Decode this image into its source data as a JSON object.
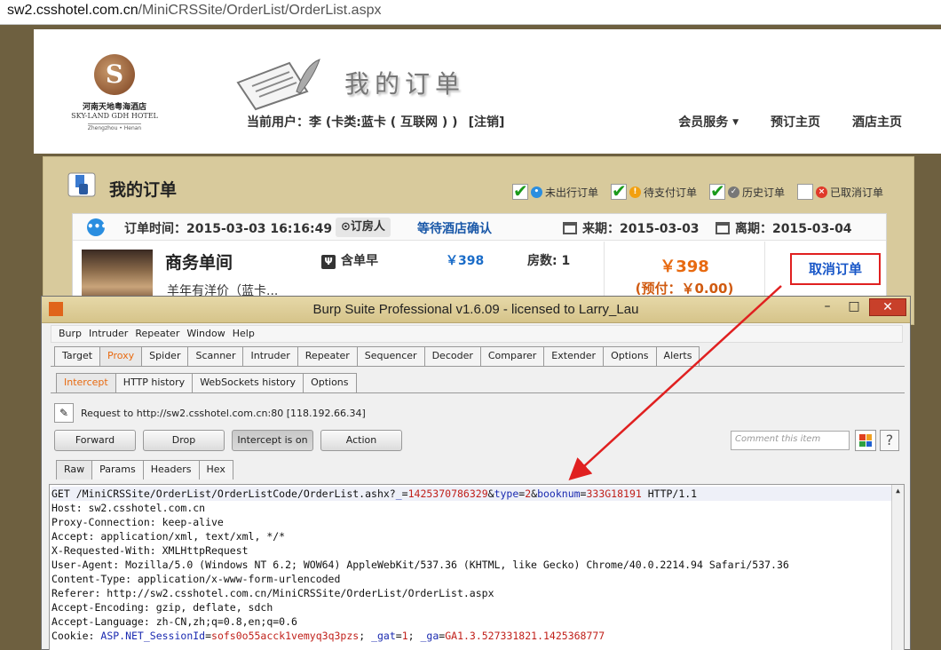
{
  "browser": {
    "url_host": "sw2.csshotel.com.cn",
    "url_path": "/MiniCRSSite/OrderList/OrderList.aspx"
  },
  "site": {
    "logo_cn": "河南天地粤海酒店",
    "logo_en": "SKY-LAND GDH HOTEL",
    "logo_sub": "Zhengzhou • Henan",
    "hero_title": "我的订单",
    "user_label": "当前用户：李 (卡类:蓝卡 ( 互联网 ) )",
    "logout": "[注销]",
    "nav": [
      "会员服务",
      "预订主页",
      "酒店主页"
    ]
  },
  "orders": {
    "title": "我的订单",
    "filters": [
      {
        "label": "未出行订单",
        "checked": true,
        "icon": "blue-dot-icon"
      },
      {
        "label": "待支付订单",
        "checked": true,
        "icon": "orange-dot-icon"
      },
      {
        "label": "历史订单",
        "checked": true,
        "icon": "gray-check-icon"
      },
      {
        "label": "已取消订单",
        "checked": false,
        "icon": "red-x-icon"
      }
    ],
    "order": {
      "order_time": "订单时间：2015-03-03 16:16:49",
      "booker": "订房人",
      "status": "等待酒店确认",
      "checkin": "来期：2015-03-03",
      "checkout": "离期：2015-03-04",
      "room_name": "商务单间",
      "room_desc": "羊年有洋价（蓝卡...",
      "breakfast": "含单早",
      "unit_price": "￥398",
      "rooms": "房数: 1",
      "total": "￥398",
      "prepay": "(预付：￥0.00)",
      "cancel": "取消订单"
    }
  },
  "burp": {
    "title": "Burp Suite Professional v1.6.09 - licensed to Larry_Lau",
    "menu": [
      "Burp",
      "Intruder",
      "Repeater",
      "Window",
      "Help"
    ],
    "tabs": [
      "Target",
      "Proxy",
      "Spider",
      "Scanner",
      "Intruder",
      "Repeater",
      "Sequencer",
      "Decoder",
      "Comparer",
      "Extender",
      "Options",
      "Alerts"
    ],
    "subtabs": [
      "Intercept",
      "HTTP history",
      "WebSockets history",
      "Options"
    ],
    "request_to": "Request to http://sw2.csshotel.com.cn:80  [118.192.66.34]",
    "buttons": [
      "Forward",
      "Drop",
      "Intercept is on",
      "Action"
    ],
    "comment_placeholder": "Comment this item",
    "view_tabs": [
      "Raw",
      "Params",
      "Headers",
      "Hex"
    ],
    "req_line": {
      "pre": "GET /MiniCRSSite/OrderList/OrderListCode/OrderList.ashx?",
      "k1": "_",
      "v1": "1425370786329",
      "k2": "type",
      "v2": "2",
      "k3": "booknum",
      "v3": "333G18191",
      "post": " HTTP/1.1"
    },
    "headers": [
      "Host: sw2.csshotel.com.cn",
      "Proxy-Connection: keep-alive",
      "Accept: application/xml, text/xml, */*",
      "X-Requested-With: XMLHttpRequest",
      "User-Agent: Mozilla/5.0 (Windows NT 6.2; WOW64) AppleWebKit/537.36 (KHTML, like Gecko) Chrome/40.0.2214.94 Safari/537.36",
      "Content-Type: application/x-www-form-urlencoded",
      "Referer: http://sw2.csshotel.com.cn/MiniCRSSite/OrderList/OrderList.aspx",
      "Accept-Encoding: gzip, deflate, sdch",
      "Accept-Language: zh-CN,zh;q=0.8,en;q=0.6"
    ],
    "cookie": {
      "pre": "Cookie: ",
      "k1": "ASP.NET_SessionId",
      "v1": "sofs0o55acck1vemyq3q3pzs",
      "mid1": "; ",
      "k2": "_gat",
      "v2": "1",
      "mid2": "; ",
      "k3": "_ga",
      "v3": "GA1.3.527331821.1425368777"
    }
  },
  "colors": {
    "highlight_red": "#e02020",
    "link_blue": "#1a58c8",
    "proxy_orange": "#e86a10"
  }
}
